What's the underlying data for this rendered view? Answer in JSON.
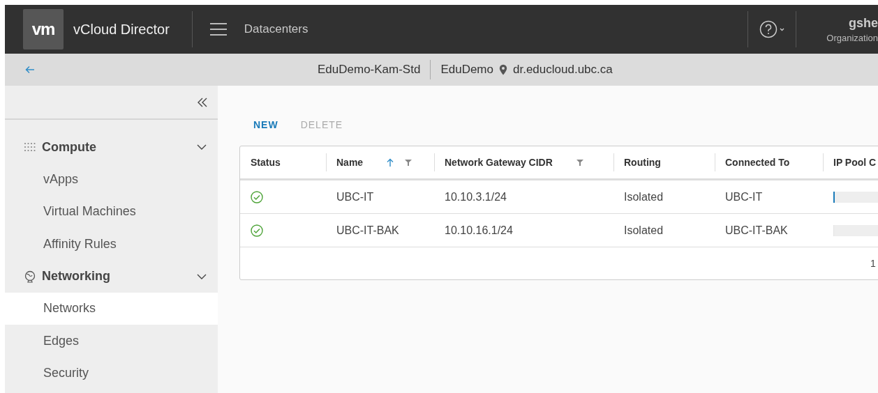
{
  "header": {
    "logo": "vm",
    "product": "vCloud Director",
    "section": "Datacenters",
    "user": "gshe",
    "role": "Organization"
  },
  "context": {
    "vdc": "EduDemo-Kam-Std",
    "org": "EduDemo",
    "site": "dr.educloud.ubc.ca"
  },
  "sidebar": {
    "groups": [
      {
        "label": "Compute",
        "expanded": true,
        "children": [
          {
            "label": "vApps",
            "selected": false
          },
          {
            "label": "Virtual Machines",
            "selected": false
          },
          {
            "label": "Affinity Rules",
            "selected": false
          }
        ]
      },
      {
        "label": "Networking",
        "expanded": true,
        "children": [
          {
            "label": "Networks",
            "selected": true
          },
          {
            "label": "Edges",
            "selected": false
          },
          {
            "label": "Security",
            "selected": false
          }
        ]
      }
    ]
  },
  "actions": [
    {
      "label": "NEW",
      "disabled": false
    },
    {
      "label": "DELETE",
      "disabled": true
    }
  ],
  "table": {
    "columns": [
      {
        "label": "Status",
        "sorted": false,
        "filter": false
      },
      {
        "label": "Name",
        "sorted": true,
        "filter": true
      },
      {
        "label": "Network Gateway CIDR",
        "sorted": false,
        "filter": true
      },
      {
        "label": "Routing",
        "sorted": false,
        "filter": false
      },
      {
        "label": "Connected To",
        "sorted": false,
        "filter": false
      },
      {
        "label": "IP Pool C"
      }
    ],
    "rows": [
      {
        "healthy": true,
        "name": "UBC-IT",
        "cidr": "10.10.3.1/24",
        "routing": "Isolated",
        "connected_to": "UBC-IT",
        "ip_pool": {
          "level": 0.03
        }
      },
      {
        "healthy": true,
        "name": "UBC-IT-BAK",
        "cidr": "10.10.16.1/24",
        "routing": "Isolated",
        "connected_to": "UBC-IT-BAK",
        "ip_pool": {
          "level": 0
        }
      }
    ],
    "footer": "1"
  }
}
